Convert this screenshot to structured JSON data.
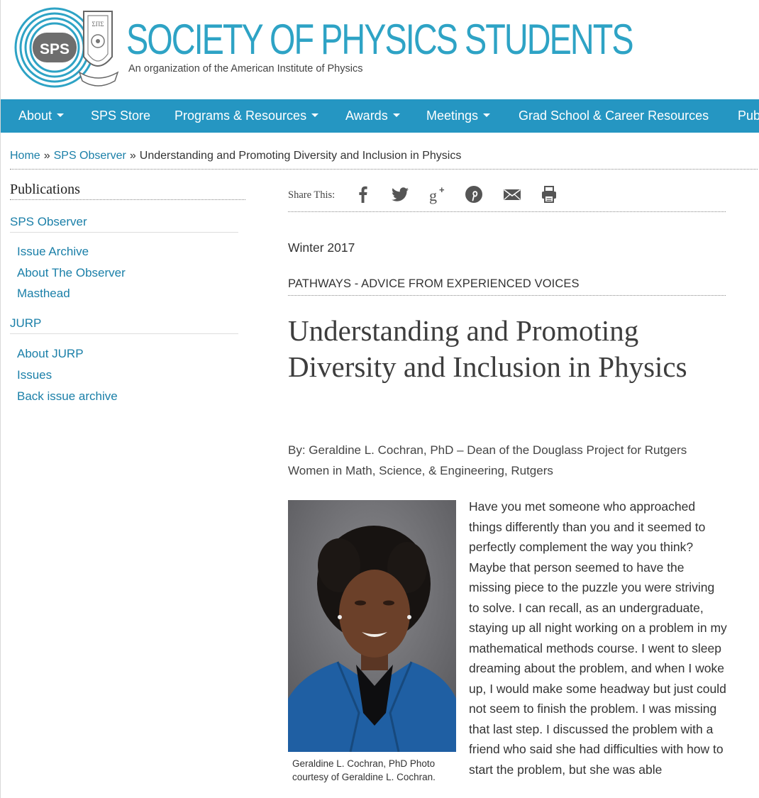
{
  "header": {
    "logo_badge": "SPS",
    "seal_text": "ΣΠΣ",
    "title": "SOCIETY OF PHYSICS STUDENTS",
    "tagline": "An organization of the American Institute of Physics"
  },
  "nav": {
    "items": [
      {
        "label": "About",
        "dropdown": true
      },
      {
        "label": "SPS Store",
        "dropdown": false
      },
      {
        "label": "Programs & Resources",
        "dropdown": true
      },
      {
        "label": "Awards",
        "dropdown": true
      },
      {
        "label": "Meetings",
        "dropdown": true
      },
      {
        "label": "Grad School & Career Resources",
        "dropdown": false
      },
      {
        "label": "Pub",
        "dropdown": false
      }
    ]
  },
  "breadcrumb": {
    "home": "Home",
    "separator": "»",
    "section": "SPS Observer",
    "current": "Understanding and Promoting Diversity and Inclusion in Physics"
  },
  "sidebar": {
    "heading": "Publications",
    "sections": [
      {
        "label": "SPS Observer",
        "links": [
          "Issue Archive",
          "About The Observer",
          "Masthead"
        ]
      },
      {
        "label": "JURP",
        "links": [
          "About JURP",
          "Issues",
          "Back issue archive"
        ]
      }
    ]
  },
  "share": {
    "label": "Share This:",
    "icons": [
      "facebook-icon",
      "twitter-icon",
      "google-plus-icon",
      "pinterest-icon",
      "email-icon",
      "print-icon"
    ]
  },
  "article": {
    "issue": "Winter 2017",
    "category": "PATHWAYS - ADVICE FROM EXPERIENCED VOICES",
    "title": "Understanding and Promoting Diversity and Inclusion in Physics",
    "byline": "By:  Geraldine L. Cochran, PhD – Dean of the Douglass Project for Rutgers Women in Math, Science, & Engineering, Rutgers",
    "photo_caption": "Geraldine L. Cochran, PhD Photo courtesy of Geraldine L. Cochran.",
    "body": "Have you met someone who approached things differently than you and it seemed to perfectly complement the way you think? Maybe that person seemed to have the missing piece to the puzzle you were striving to solve. I can recall, as an undergraduate, staying up all night working on a problem in my mathematical methods course. I went to sleep dreaming about the problem, and when I woke up, I would make some headway but just could not seem to finish the problem. I was missing that last step. I discussed the problem with a friend who said she had difficulties with how to start the problem, but she was able"
  },
  "colors": {
    "brand": "#2ea3c5",
    "nav_bg": "#2596c2",
    "link": "#1a7fa8"
  }
}
